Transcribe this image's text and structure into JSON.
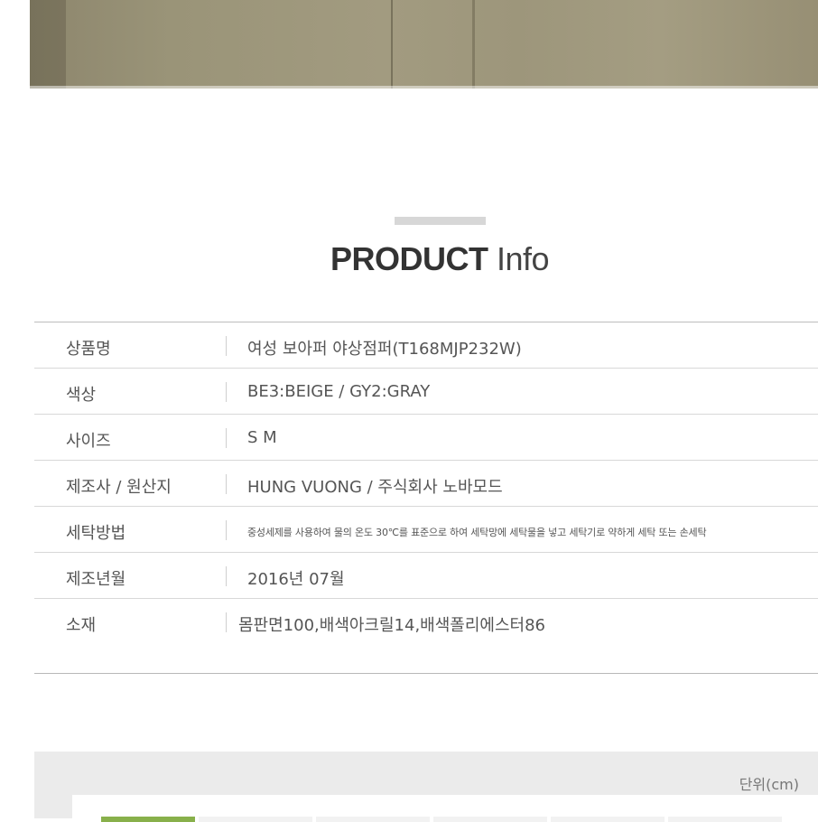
{
  "section_title": {
    "strong": "PRODUCT",
    "light": "Info"
  },
  "info_rows": [
    {
      "label": "상품명",
      "value": "여성 보아퍼 야상점퍼(T168MJP232W)"
    },
    {
      "label": "색상",
      "value": "BE3:BEIGE / GY2:GRAY"
    },
    {
      "label": "사이즈",
      "value": "S M"
    },
    {
      "label": "제조사 / 원산지",
      "value": "HUNG VUONG / 주식회사 노바모드"
    },
    {
      "label": "세탁방법",
      "value": "중성세제를 사용하여 물의 온도 30℃를 표준으로 하여 세탁망에 세탁물을 넣고 세탁기로 약하게 세탁 또는 손세탁"
    },
    {
      "label": "제조년월",
      "value": "2016년 07월"
    },
    {
      "label": "소재",
      "value": "몸판면100,배색아크릴14,배색폴리에스터86"
    }
  ],
  "size_chart": {
    "unit_label": "단위(cm)"
  },
  "colors": {
    "accent_green": "#88b04b",
    "photo_khaki": "#9d967b"
  }
}
